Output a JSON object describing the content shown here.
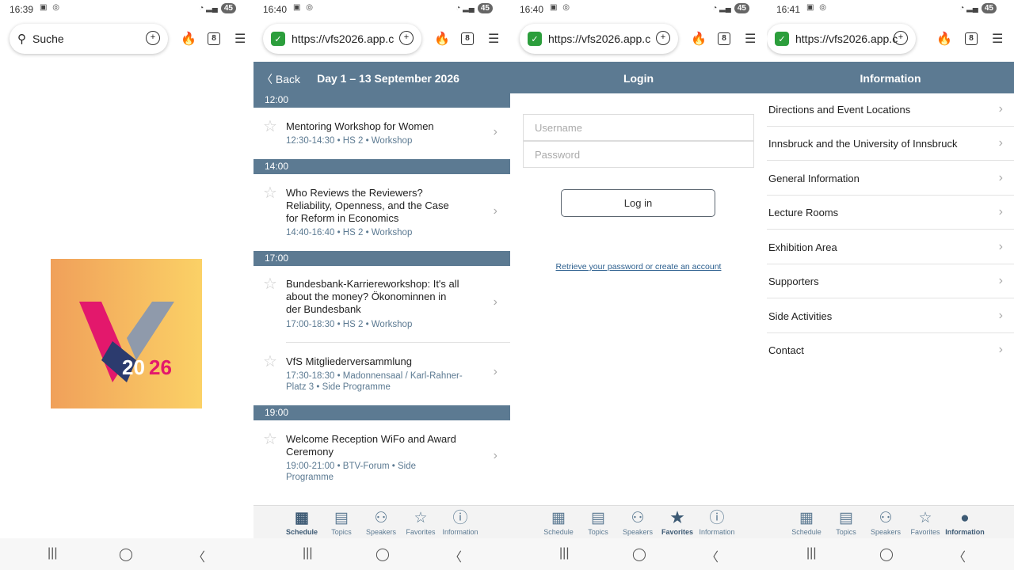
{
  "panels": [
    {
      "status_time": "16:39",
      "battery": "45",
      "url": "Suche",
      "tabs": "8"
    },
    {
      "status_time": "16:40",
      "battery": "45",
      "url": "https://vfs2026.app.c",
      "tabs": "8"
    },
    {
      "status_time": "16:40",
      "battery": "45",
      "url": "https://vfs2026.app.c",
      "tabs": "8"
    },
    {
      "status_time": "16:41",
      "battery": "45",
      "url": "https://vfs2026.app.c",
      "tabs": "8"
    }
  ],
  "logo": {
    "text_20": "20",
    "text_26": "26",
    "colors": {
      "pink": "#e3186c",
      "navy": "#2c3b6e",
      "grey": "#8f9aab",
      "white": "#ffffff"
    }
  },
  "schedule": {
    "back_label": "Back",
    "title": "Day 1 – 13 September 2026",
    "sections": [
      {
        "time": "12:00",
        "sessions": [
          {
            "title": "Mentoring Workshop for Women",
            "meta": "12:30-14:30 • HS 2 • Workshop"
          }
        ]
      },
      {
        "time": "14:00",
        "sessions": [
          {
            "title": "Who Reviews the Reviewers? Reliability, Openness, and the Case for Reform in Economics",
            "meta": "14:40-16:40 • HS 2 • Workshop"
          }
        ]
      },
      {
        "time": "17:00",
        "sessions": [
          {
            "title": "Bundesbank-Karriereworkshop: It's all about the money? Ökonominnen in der Bundesbank",
            "meta": "17:00-18:30 • HS 2 • Workshop"
          },
          {
            "title": "VfS Mitgliederversammlung",
            "meta": "17:30-18:30 • Madonnensaal / Karl-Rahner-Platz 3 • Side Programme"
          }
        ]
      },
      {
        "time": "19:00",
        "sessions": [
          {
            "title": "Welcome Reception WiFo and Award Ceremony",
            "meta": "19:00-21:00 • BTV-Forum • Side Programme"
          }
        ]
      }
    ]
  },
  "login": {
    "title": "Login",
    "username_placeholder": "Username",
    "password_placeholder": "Password",
    "button_label": "Log in",
    "link_text": "Retrieve your password or create an account"
  },
  "information": {
    "title": "Information",
    "items": [
      "Directions and Event Locations",
      "Innsbruck and the University of Innsbruck",
      "General Information",
      "Lecture Rooms",
      "Exhibition Area",
      "Supporters",
      "Side Activities",
      "Contact"
    ]
  },
  "tabbar": {
    "items": [
      {
        "label": "Schedule",
        "icon": "calendar-icon"
      },
      {
        "label": "Topics",
        "icon": "book-icon"
      },
      {
        "label": "Speakers",
        "icon": "people-icon"
      },
      {
        "label": "Favorites",
        "icon": "star-icon"
      },
      {
        "label": "Information",
        "icon": "info-icon"
      }
    ],
    "accent": "#5c7a92"
  }
}
